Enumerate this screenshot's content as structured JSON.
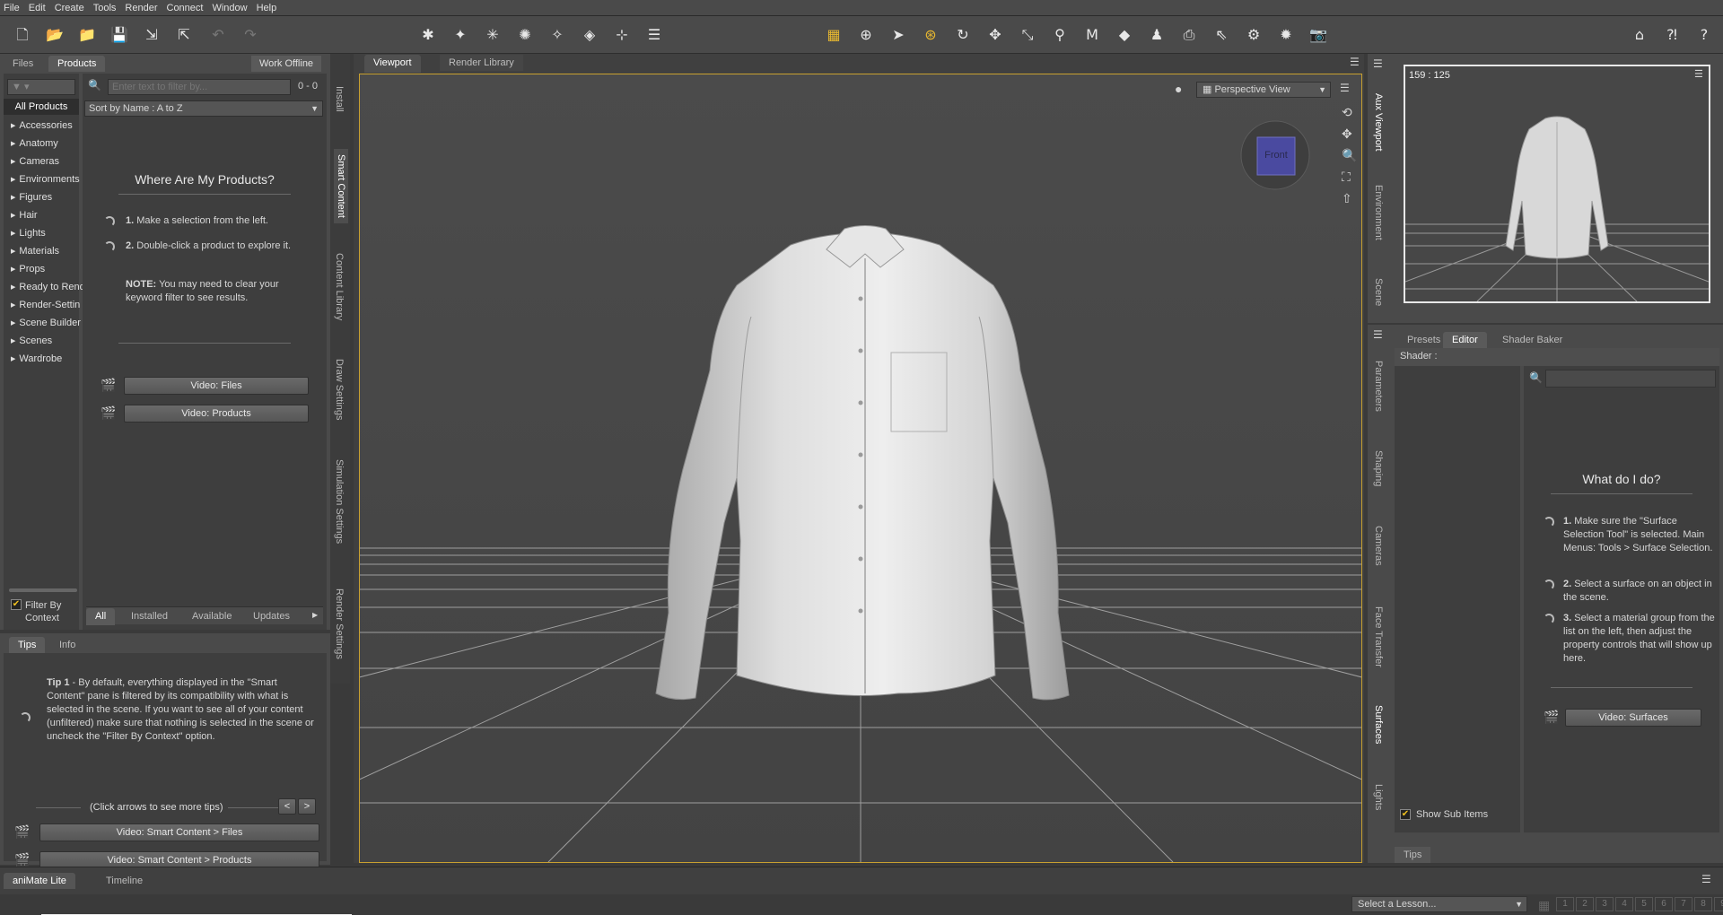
{
  "menu": [
    "File",
    "Edit",
    "Create",
    "Tools",
    "Render",
    "Connect",
    "Window",
    "Help"
  ],
  "left": {
    "tabs": {
      "files": "Files",
      "products": "Products"
    },
    "work_offline": "Work Offline",
    "filter_placeholder": "Enter text to filter by...",
    "filter_count": "0 - 0",
    "sort": "Sort by Name : A to Z",
    "all_products": "All Products",
    "categories": [
      "Accessories",
      "Anatomy",
      "Cameras",
      "Environments",
      "Figures",
      "Hair",
      "Lights",
      "Materials",
      "Props",
      "Ready to Rend",
      "Render-Settin",
      "Scene Builder",
      "Scenes",
      "Wardrobe"
    ],
    "where_title": "Where Are My Products?",
    "step1_num": "1.",
    "step1": "Make a selection from the left.",
    "step2_num": "2.",
    "step2": "Double-click a product to explore it.",
    "note_label": "NOTE:",
    "note": "You may need to clear your keyword filter to see results.",
    "video_files": "Video: Files",
    "video_products": "Video: Products",
    "filter_by_context": "Filter By Context",
    "bottom_tabs": {
      "all": "All",
      "installed": "Installed",
      "available": "Available",
      "updates": "Updates"
    },
    "vertical_tabs": [
      "Install",
      "Smart Content",
      "Content Library",
      "Draw Settings",
      "Simulation Settings",
      "Render Settings"
    ]
  },
  "tips": {
    "tabs": {
      "tips": "Tips",
      "info": "Info"
    },
    "tip_label": "Tip 1",
    "tip_text": " - By default, everything displayed in the \"Smart Content\" pane is filtered by its compatibility with what is selected in the scene. If you want to see all of your content (unfiltered) make sure that nothing is selected in the scene or uncheck the \"Filter By Context\" option.",
    "arrows_hint": "(Click arrows to see more tips)",
    "prev": "<",
    "next": ">",
    "video1": "Video: Smart Content > Files",
    "video2": "Video: Smart Content > Products"
  },
  "viewport": {
    "tabs": {
      "viewport": "Viewport",
      "render_library": "Render Library"
    },
    "view_mode": "Perspective View",
    "cube_label": "Front"
  },
  "aux": {
    "ratio": "159 : 125",
    "vertical_tabs": [
      "Aux Viewport",
      "Environment",
      "Scene"
    ]
  },
  "surfaces": {
    "tabs": {
      "presets": "Presets",
      "editor": "Editor",
      "shader_baker": "Shader Baker"
    },
    "shader_label": "Shader :",
    "title": "What do I do?",
    "steps": [
      {
        "num": "1.",
        "text": "Make sure the \"Surface Selection Tool\" is selected. Main Menus: Tools > Surface Selection."
      },
      {
        "num": "2.",
        "text": "Select a surface on an object in the scene."
      },
      {
        "num": "3.",
        "text": "Select a material group from the list on the left, then adjust the property controls that will show up here."
      }
    ],
    "video": "Video: Surfaces",
    "show_sub_items": "Show Sub Items",
    "tips_tab": "Tips",
    "vertical_tabs": [
      "Parameters",
      "Shaping",
      "Cameras",
      "Face Transfer",
      "Surfaces",
      "Lights"
    ]
  },
  "bottom": {
    "tabs": {
      "animate": "aniMate Lite",
      "timeline": "Timeline"
    },
    "lesson": "Select a Lesson...",
    "pages": [
      "1",
      "2",
      "3",
      "4",
      "5",
      "6",
      "7",
      "8",
      "9"
    ]
  }
}
